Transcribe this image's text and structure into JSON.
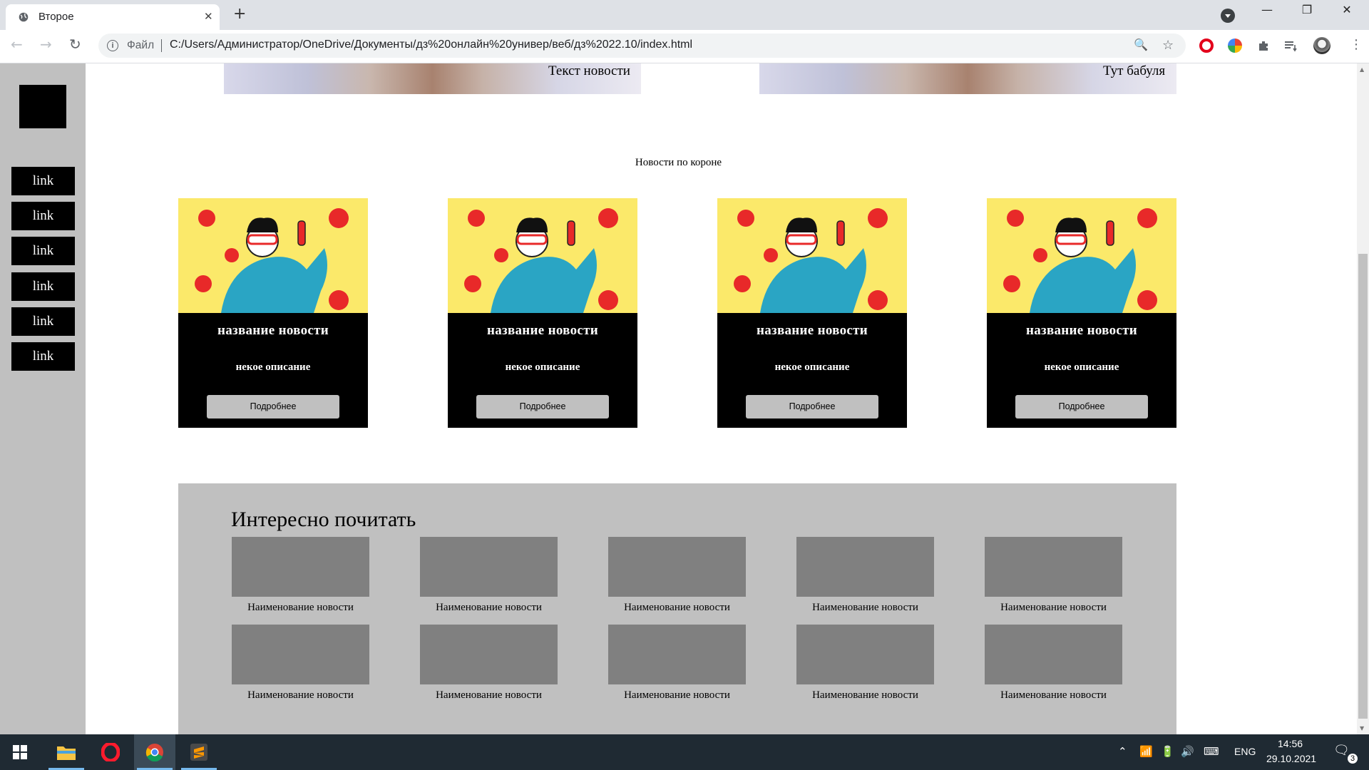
{
  "browser": {
    "tab_title": "Второе",
    "tab_close": "✕",
    "new_tab": "+",
    "window_controls": {
      "minimize": "—",
      "restore": "❐",
      "close": "✕"
    },
    "url_prefix": "Файл",
    "url": "C:/Users/Администратор/OneDrive/Документы/дз%20онлайн%20универ/веб/дз%2022.10/index.html",
    "nav": {
      "back": "←",
      "forward": "→",
      "reload": "↻"
    },
    "zoom_icon": "🔍",
    "bookmark_icon": "☆"
  },
  "page": {
    "sidebar_links": [
      "link",
      "link",
      "link",
      "link",
      "link",
      "link"
    ],
    "hero_captions": [
      "Текст новости",
      "Тут бабуля"
    ],
    "section_title": "Новости по короне",
    "cards": [
      {
        "title": "название новости",
        "description": "некое описание",
        "button": "Подробнее"
      },
      {
        "title": "название новости",
        "description": "некое описание",
        "button": "Подробнее"
      },
      {
        "title": "название новости",
        "description": "некое описание",
        "button": "Подробнее"
      },
      {
        "title": "название новости",
        "description": "некое описание",
        "button": "Подробнее"
      }
    ],
    "read_title": "Интересно почитать",
    "read_items": [
      "Наименование новости",
      "Наименование новости",
      "Наименование новости",
      "Наименование новости",
      "Наименование новости",
      "Наименование новости",
      "Наименование новости",
      "Наименование новости",
      "Наименование новости",
      "Наименование новости"
    ]
  },
  "taskbar": {
    "language": "ENG",
    "time": "14:56",
    "date": "29.10.2021",
    "notification_count": "3"
  },
  "colors": {
    "sidebar": "#c0c0c0",
    "card_bg": "#000000",
    "card_image_bg": "#fbe96a",
    "tile": "#808080",
    "taskbar": "#1f2a33"
  }
}
